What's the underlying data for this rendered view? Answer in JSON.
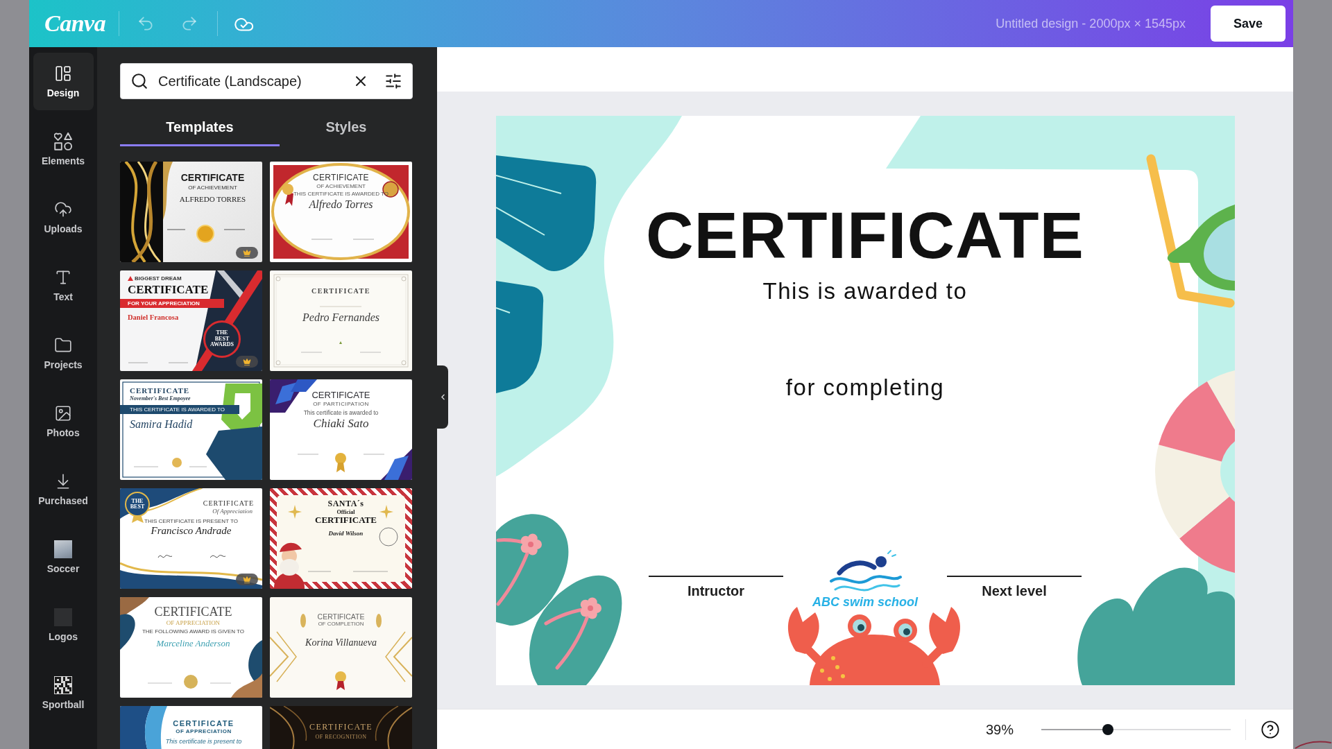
{
  "top_bar": {
    "logo": "Canva",
    "actions": [
      {
        "kind": "undo",
        "disabled": true
      },
      {
        "kind": "redo",
        "disabled": true
      },
      {
        "kind": "saved",
        "disabled": false
      }
    ],
    "title": "Untitled design - 2000px × 1545px",
    "save_button": "Save"
  },
  "sidebar": {
    "items": [
      {
        "label": "Design",
        "kind": "design",
        "selected": true
      },
      {
        "label": "Elements",
        "kind": "elements",
        "selected": false
      },
      {
        "label": "Uploads",
        "kind": "uploads",
        "selected": false
      },
      {
        "label": "Text",
        "kind": "text",
        "selected": false
      },
      {
        "label": "Projects",
        "kind": "projects",
        "selected": false
      },
      {
        "label": "Photos",
        "kind": "photos",
        "selected": false
      },
      {
        "label": "Purchased",
        "kind": "purchased",
        "selected": false
      },
      {
        "label": "Soccer",
        "kind": "photo-app",
        "selected": false
      },
      {
        "label": "Logos",
        "kind": "image-app",
        "selected": false
      },
      {
        "label": "Sportball",
        "kind": "qr-app",
        "selected": false
      }
    ]
  },
  "panel": {
    "search": {
      "value": "Certificate (Landscape)"
    },
    "tabs": [
      {
        "label": "Templates",
        "selected": true
      },
      {
        "label": "Styles",
        "selected": false
      }
    ],
    "templates": [
      {
        "kind": "swirl",
        "premium": true,
        "lines": [
          {
            "kind": "title",
            "text": "CERTIFICATE"
          },
          {
            "kind": "subtitle",
            "text": "OF ACHIEVEMENT"
          },
          {
            "kind": "name",
            "text": "ALFREDO TORRES"
          }
        ]
      },
      {
        "kind": "oval",
        "premium": false,
        "lines": [
          {
            "kind": "title",
            "text": "CERTIFICATE"
          },
          {
            "kind": "subtitle",
            "text": "OF ACHIEVEMENT"
          },
          {
            "kind": "caption",
            "text": "THIS CERTIFICATE IS AWARDED TO"
          },
          {
            "kind": "name",
            "text": "Alfredo Torres"
          }
        ]
      },
      {
        "kind": "diagonal",
        "premium": true,
        "lines": [
          {
            "kind": "brand",
            "text": "BIGGEST DREAM"
          },
          {
            "kind": "title",
            "text": "CERTIFICATE"
          },
          {
            "kind": "band",
            "text": "FOR YOUR APPRECIATION"
          },
          {
            "kind": "name",
            "text": "Daniel Francosa"
          },
          {
            "kind": "badge",
            "text": "THE BEST AWARDS"
          }
        ]
      },
      {
        "kind": "classic",
        "premium": false,
        "lines": [
          {
            "kind": "title",
            "text": "CERTIFICATE"
          },
          {
            "kind": "name",
            "text": "Pedro Fernandes"
          }
        ]
      },
      {
        "kind": "geometric",
        "premium": false,
        "lines": [
          {
            "kind": "title",
            "text": "CERTIFICATE"
          },
          {
            "kind": "subtitle",
            "text": "November's Best Empoyee"
          },
          {
            "kind": "band",
            "text": "THIS CERTIFICATE IS AWARDED TO"
          },
          {
            "kind": "name",
            "text": "Samira Hadid"
          }
        ]
      },
      {
        "kind": "angled",
        "premium": false,
        "lines": [
          {
            "kind": "title",
            "text": "CERTIFICATE"
          },
          {
            "kind": "subtitle",
            "text": "OF PARTICIPATION"
          },
          {
            "kind": "caption",
            "text": "This certificate is awarded to"
          },
          {
            "kind": "name",
            "text": "Chiaki Sato"
          }
        ]
      },
      {
        "kind": "ribbon",
        "premium": true,
        "lines": [
          {
            "kind": "badge",
            "text": "THE BEST"
          },
          {
            "kind": "title",
            "text": "CERTIFICATE"
          },
          {
            "kind": "subtitle",
            "text": "Of Appreciation"
          },
          {
            "kind": "caption",
            "text": "THIS CERTIFICATE IS PRESENT TO"
          },
          {
            "kind": "name",
            "text": "Francisco Andrade"
          }
        ]
      },
      {
        "kind": "santa",
        "premium": false,
        "lines": [
          {
            "kind": "heading",
            "text": "SANTA´s"
          },
          {
            "kind": "subtitle",
            "text": "Official"
          },
          {
            "kind": "title",
            "text": "CERTIFICATE"
          },
          {
            "kind": "name",
            "text": "David Wilson"
          }
        ]
      },
      {
        "kind": "fluid",
        "premium": false,
        "lines": [
          {
            "kind": "title",
            "text": "CERTIFICATE"
          },
          {
            "kind": "subtitle",
            "text": "OF APPRECIATION"
          },
          {
            "kind": "caption",
            "text": "THE FOLLOWING AWARD IS GIVEN TO"
          },
          {
            "kind": "name",
            "text": "Marceline Anderson"
          }
        ]
      },
      {
        "kind": "chevron",
        "premium": false,
        "lines": [
          {
            "kind": "title",
            "text": "CERTIFICATE"
          },
          {
            "kind": "subtitle",
            "text": "OF COMPLETION"
          },
          {
            "kind": "name",
            "text": "Korina Villanueva"
          }
        ]
      },
      {
        "kind": "wave",
        "premium": false,
        "lines": [
          {
            "kind": "title",
            "text": "CERTIFICATE"
          },
          {
            "kind": "subtitle",
            "text": "OF APPRECIATION"
          },
          {
            "kind": "caption",
            "text": "This certificate is present to"
          }
        ]
      },
      {
        "kind": "arch",
        "premium": false,
        "lines": [
          {
            "kind": "title",
            "text": "CERTIFICATE"
          },
          {
            "kind": "subtitle",
            "text": "OF RECOGNITION"
          }
        ]
      }
    ]
  },
  "canvas": {
    "certificate": {
      "title": "CERTIFICATE",
      "awarded_line": "This is awarded to",
      "completing_line": "for completing",
      "signatures": [
        "Intructor",
        "Next level"
      ],
      "school_name": "ABC swim school"
    }
  },
  "footer": {
    "zoom_label": "39%",
    "zoom_slider": {
      "level": 0.35
    }
  }
}
